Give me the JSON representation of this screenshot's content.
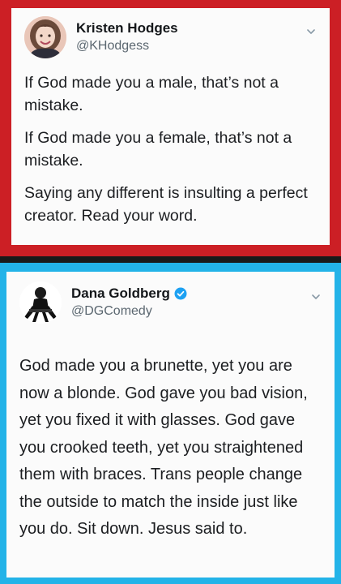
{
  "tweets": [
    {
      "display_name": "Kristen Hodges",
      "handle": "@KHodgess",
      "verified": false,
      "paragraphs": [
        "If God made you a male, that’s not a mistake.",
        "If God made you a female, that’s not a mistake.",
        "Saying any different is insulting a perfect creator. Read your word."
      ],
      "border_color": "#cc1f25"
    },
    {
      "display_name": "Dana Goldberg",
      "handle": "@DGComedy",
      "verified": true,
      "text": "God made you a brunette, yet you are now a blonde. God gave you bad vision, yet you fixed it with glasses. God gave you crooked teeth, yet you straightened them with braces. Trans people change the outside to match the inside just like you do. Sit down. Jesus said to.",
      "border_color": "#23b3e8"
    }
  ],
  "icons": {
    "menu": "chevron-down-icon",
    "verified": "verified-badge-icon"
  }
}
